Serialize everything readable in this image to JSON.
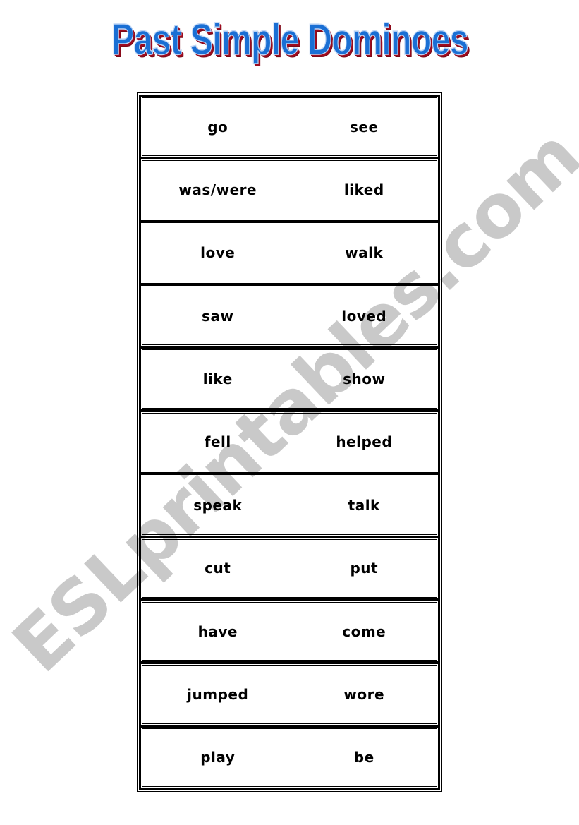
{
  "title": "Past Simple Dominoes",
  "watermark": "ESLprintables.com",
  "dominoes": [
    {
      "left": "go",
      "right": "see"
    },
    {
      "left": "was/were",
      "right": "liked"
    },
    {
      "left": "love",
      "right": "walk"
    },
    {
      "left": "saw",
      "right": "loved"
    },
    {
      "left": "like",
      "right": "show"
    },
    {
      "left": "fell",
      "right": "helped"
    },
    {
      "left": "speak",
      "right": "talk"
    },
    {
      "left": "cut",
      "right": "put"
    },
    {
      "left": "have",
      "right": "come"
    },
    {
      "left": "jumped",
      "right": "wore"
    },
    {
      "left": "play",
      "right": "be"
    }
  ],
  "colors": {
    "title_fill": "#1a6fd4",
    "title_shadow": "#9e0b1e",
    "watermark": "#bdbdbd"
  }
}
